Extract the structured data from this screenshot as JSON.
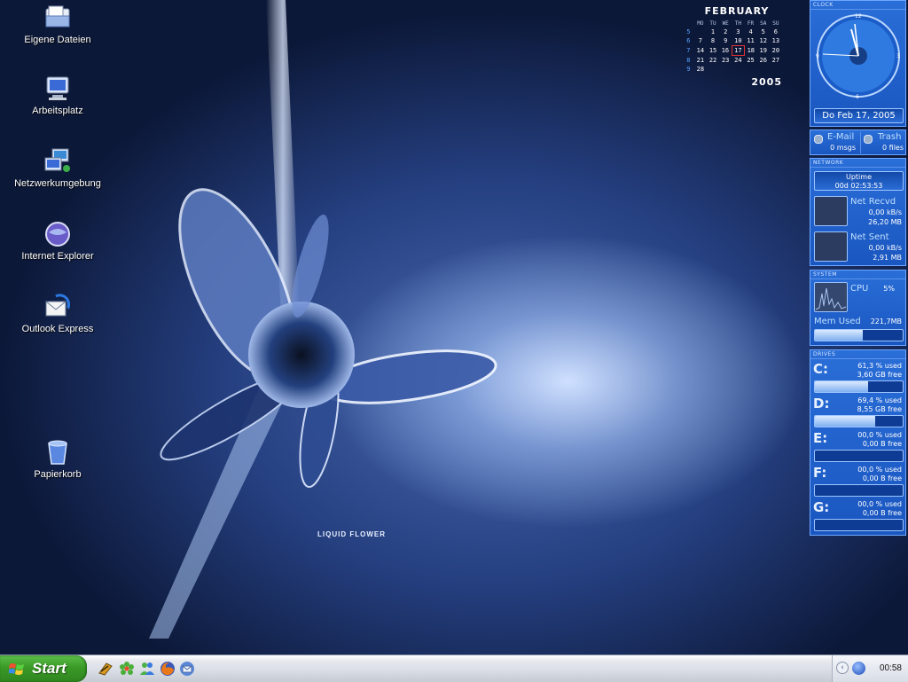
{
  "desktop": {
    "icons": [
      {
        "label": "Eigene Dateien"
      },
      {
        "label": "Arbeitsplatz"
      },
      {
        "label": "Netzwerkumgebung"
      },
      {
        "label": "Internet Explorer"
      },
      {
        "label": "Outlook Express"
      },
      {
        "label": "Papierkorb"
      }
    ],
    "wallpaper_brand": "LIQUID FLOWER"
  },
  "calendar": {
    "month": "FEBRUARY",
    "year": "2005",
    "weekdays": [
      "MO",
      "TU",
      "WE",
      "TH",
      "FR",
      "SA",
      "SU"
    ],
    "weeks": [
      {
        "wk": "5",
        "days": [
          "",
          "1",
          "2",
          "3",
          "4",
          "5",
          "6"
        ]
      },
      {
        "wk": "6",
        "days": [
          "7",
          "8",
          "9",
          "10",
          "11",
          "12",
          "13"
        ]
      },
      {
        "wk": "7",
        "days": [
          "14",
          "15",
          "16",
          "17",
          "18",
          "19",
          "20"
        ]
      },
      {
        "wk": "8",
        "days": [
          "21",
          "22",
          "23",
          "24",
          "25",
          "26",
          "27"
        ]
      },
      {
        "wk": "9",
        "days": [
          "28",
          "",
          "",
          "",
          "",
          "",
          ""
        ]
      }
    ],
    "today": "17"
  },
  "widgets": {
    "clock": {
      "title": "CLOCK",
      "date": "Do Feb 17, 2005",
      "dial": [
        "12",
        "3",
        "6",
        "9"
      ]
    },
    "email": {
      "label": "E-Mail",
      "value": "0 msgs"
    },
    "trash": {
      "label": "Trash",
      "value": "0 files"
    },
    "network": {
      "title": "NETWORK",
      "uptime_label": "Uptime",
      "uptime": "00d 02:53:53",
      "recv_label": "Net Recvd",
      "recv_rate": "0,00 kB/s",
      "recv_total": "26,20 MB",
      "sent_label": "Net Sent",
      "sent_rate": "0,00 kB/s",
      "sent_total": "2,91 MB"
    },
    "system": {
      "title": "SYSTEM",
      "cpu_label": "CPU",
      "cpu_value": "5%",
      "mem_label": "Mem Used",
      "mem_value": "221,7MB",
      "mem_fraction": 0.55
    },
    "drives": {
      "title": "DRIVES",
      "items": [
        {
          "letter": "C:",
          "used": "61,3 % used",
          "free": "3,60 GB free",
          "fraction": 0.61
        },
        {
          "letter": "D:",
          "used": "69,4 % used",
          "free": "8,55 GB free",
          "fraction": 0.69
        },
        {
          "letter": "E:",
          "used": "00,0 % used",
          "free": "0,00 B free",
          "fraction": 0
        },
        {
          "letter": "F:",
          "used": "00,0 % used",
          "free": "0,00 B free",
          "fraction": 0
        },
        {
          "letter": "G:",
          "used": "00,0 % used",
          "free": "0,00 B free",
          "fraction": 0
        }
      ]
    }
  },
  "taskbar": {
    "start_label": "Start",
    "clock": "00:58",
    "quicklaunch": [
      "winamp-icon",
      "icq-icon",
      "messenger-icon",
      "firefox-icon",
      "thunderbird-icon"
    ]
  }
}
